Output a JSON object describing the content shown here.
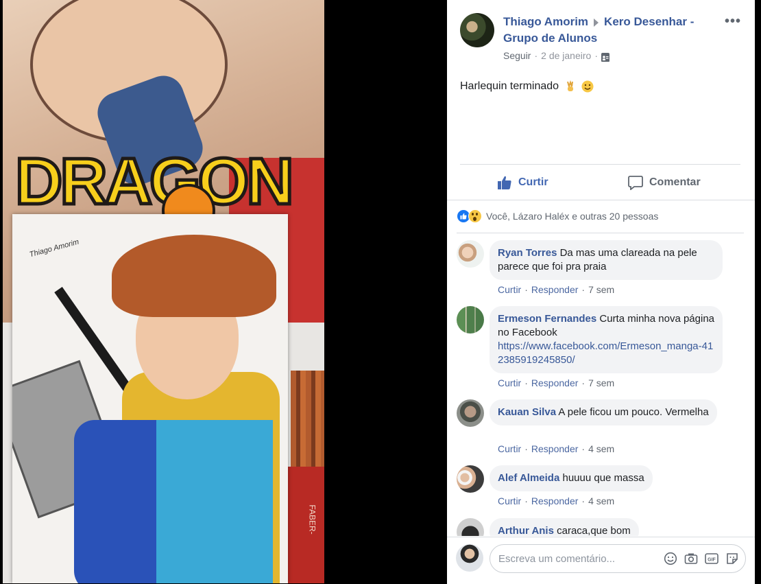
{
  "post": {
    "author_name": "Thiago Amorim",
    "group_name": "Kero Desenhar - Grupo de Alunos",
    "follow_label": "Seguir",
    "date": "2 de janeiro",
    "text": "Harlequin terminado"
  },
  "photo": {
    "poster_text": "DRAGON BA",
    "box_text": "FABER-",
    "signature": "Thiago Amorim"
  },
  "actions": {
    "like_label": "Curtir",
    "comment_label": "Comentar"
  },
  "reactions": {
    "summary": "Você, Lázaro Haléx e outras 20 pessoas"
  },
  "comments": [
    {
      "name": "Ryan Torres",
      "text": "Da mas uma clareada na pele parece que foi pra praia",
      "like": "Curtir",
      "reply": "Responder",
      "time": "7 sem"
    },
    {
      "name": "Ermeson Fernandes",
      "text": "Curta minha nova página no Facebook",
      "link": "https://www.facebook.com/Ermeson_manga-412385919245850/",
      "like": "Curtir",
      "reply": "Responder",
      "time": "7 sem"
    },
    {
      "name": "Kauan Silva",
      "text": "A pele ficou um pouco. Vermelha",
      "like": "Curtir",
      "reply": "Responder",
      "time": "4 sem"
    },
    {
      "name": "Alef Almeida",
      "text": "huuuu que massa",
      "like": "Curtir",
      "reply": "Responder",
      "time": "4 sem"
    },
    {
      "name": "Arthur Anis",
      "text": "caraca,que bom"
    }
  ],
  "composer": {
    "placeholder": "Escreva um comentário..."
  },
  "icons": {
    "more": "more-options-icon",
    "privacy": "group-privacy-icon",
    "like": "thumbs-up-icon",
    "comment": "speech-bubble-icon",
    "emoji": "smiley-icon",
    "camera": "camera-icon",
    "gif": "gif-icon",
    "sticker": "sticker-icon"
  },
  "colors": {
    "link_blue": "#385898",
    "action_blue": "#4267b2",
    "bubble_bg": "#f2f3f5",
    "meta_gray": "#90949c"
  }
}
